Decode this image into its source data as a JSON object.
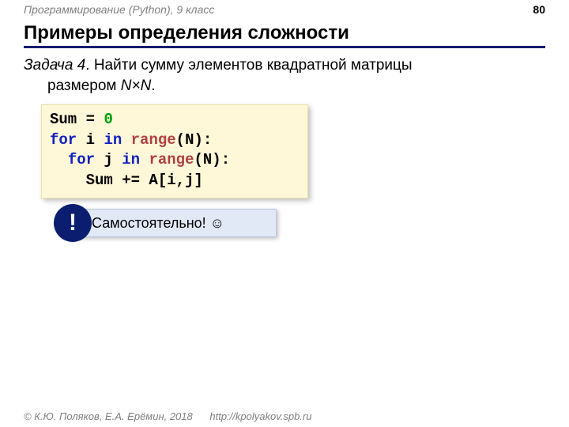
{
  "header": {
    "course": "Программирование (Python), 9 класс"
  },
  "page_number": "80",
  "title": "Примеры определения сложности",
  "task": {
    "label": "Задача 4",
    "text_line1": ". Найти сумму элементов квадратной матрицы",
    "text_line2": "размером ",
    "size_expr": "N×N",
    "period": "."
  },
  "code": {
    "l1a": "Sum",
    "l1b": " = ",
    "l1c": "0",
    "l2a": "for",
    "l2b": " i ",
    "l2c": "in",
    "l2d": " ",
    "l2e": "range",
    "l2f": "(N):",
    "l3a": "  ",
    "l3b": "for",
    "l3c": " j ",
    "l3d": "in",
    "l3e": " ",
    "l3f": "range",
    "l3g": "(N):",
    "l4": "    Sum += A[i,j]"
  },
  "callout": {
    "bang": "!",
    "text": "Самостоятельно! ☺"
  },
  "footer": {
    "copyright": "© К.Ю. Поляков, Е.А. Ерёмин, 2018",
    "url": "http://kpolyakov.spb.ru"
  }
}
